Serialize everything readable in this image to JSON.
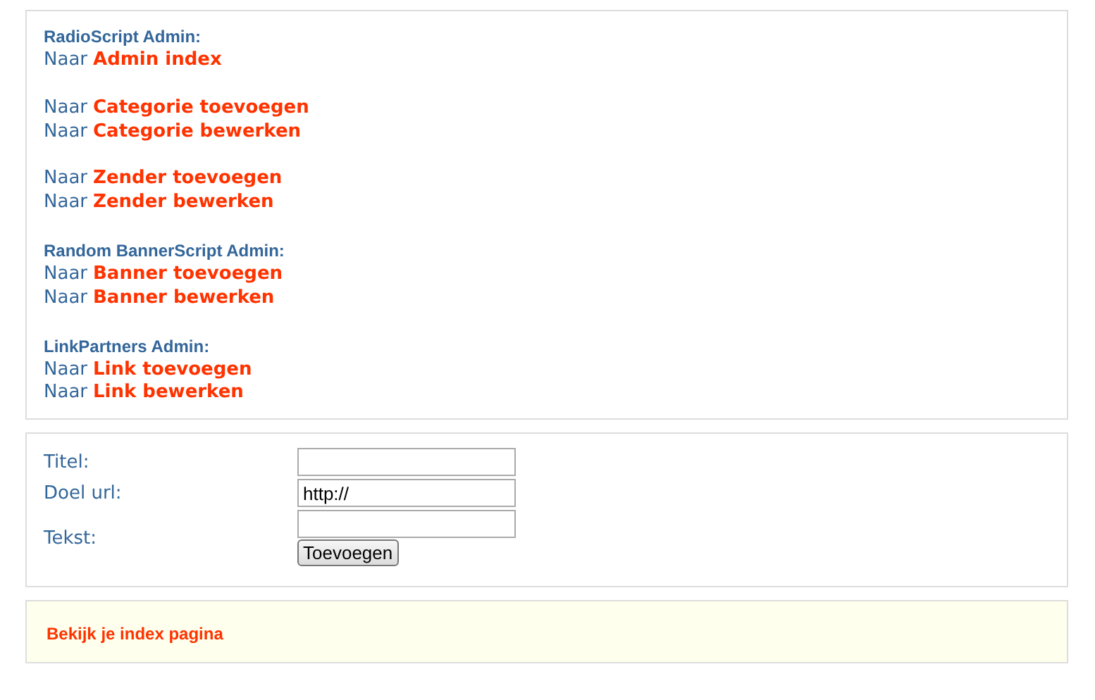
{
  "nav": [
    {
      "heading": "RadioScript Admin:",
      "links": [
        {
          "prefix": "Naar",
          "label": "Admin index"
        }
      ]
    },
    {
      "links": [
        {
          "prefix": "Naar",
          "label": "Categorie toevoegen"
        },
        {
          "prefix": "Naar",
          "label": "Categorie bewerken"
        }
      ]
    },
    {
      "links": [
        {
          "prefix": "Naar",
          "label": "Zender toevoegen"
        },
        {
          "prefix": "Naar",
          "label": "Zender bewerken"
        }
      ]
    },
    {
      "heading": "Random BannerScript Admin:",
      "links": [
        {
          "prefix": "Naar",
          "label": "Banner toevoegen"
        },
        {
          "prefix": "Naar",
          "label": "Banner bewerken"
        }
      ]
    },
    {
      "heading": "LinkPartners Admin:",
      "links": [
        {
          "prefix": "Naar",
          "label": "Link toevoegen"
        },
        {
          "prefix": "Naar",
          "label": "Link bewerken"
        }
      ]
    }
  ],
  "form": {
    "fields": [
      {
        "label": "Titel:",
        "kind": "input"
      },
      {
        "label": "Doel url:",
        "kind": "input",
        "value": "http://"
      },
      {
        "label": "Tekst:",
        "kind": "input"
      }
    ],
    "submit": "Toevoegen"
  },
  "footer": {
    "link": "Bekijk je index pagina"
  }
}
